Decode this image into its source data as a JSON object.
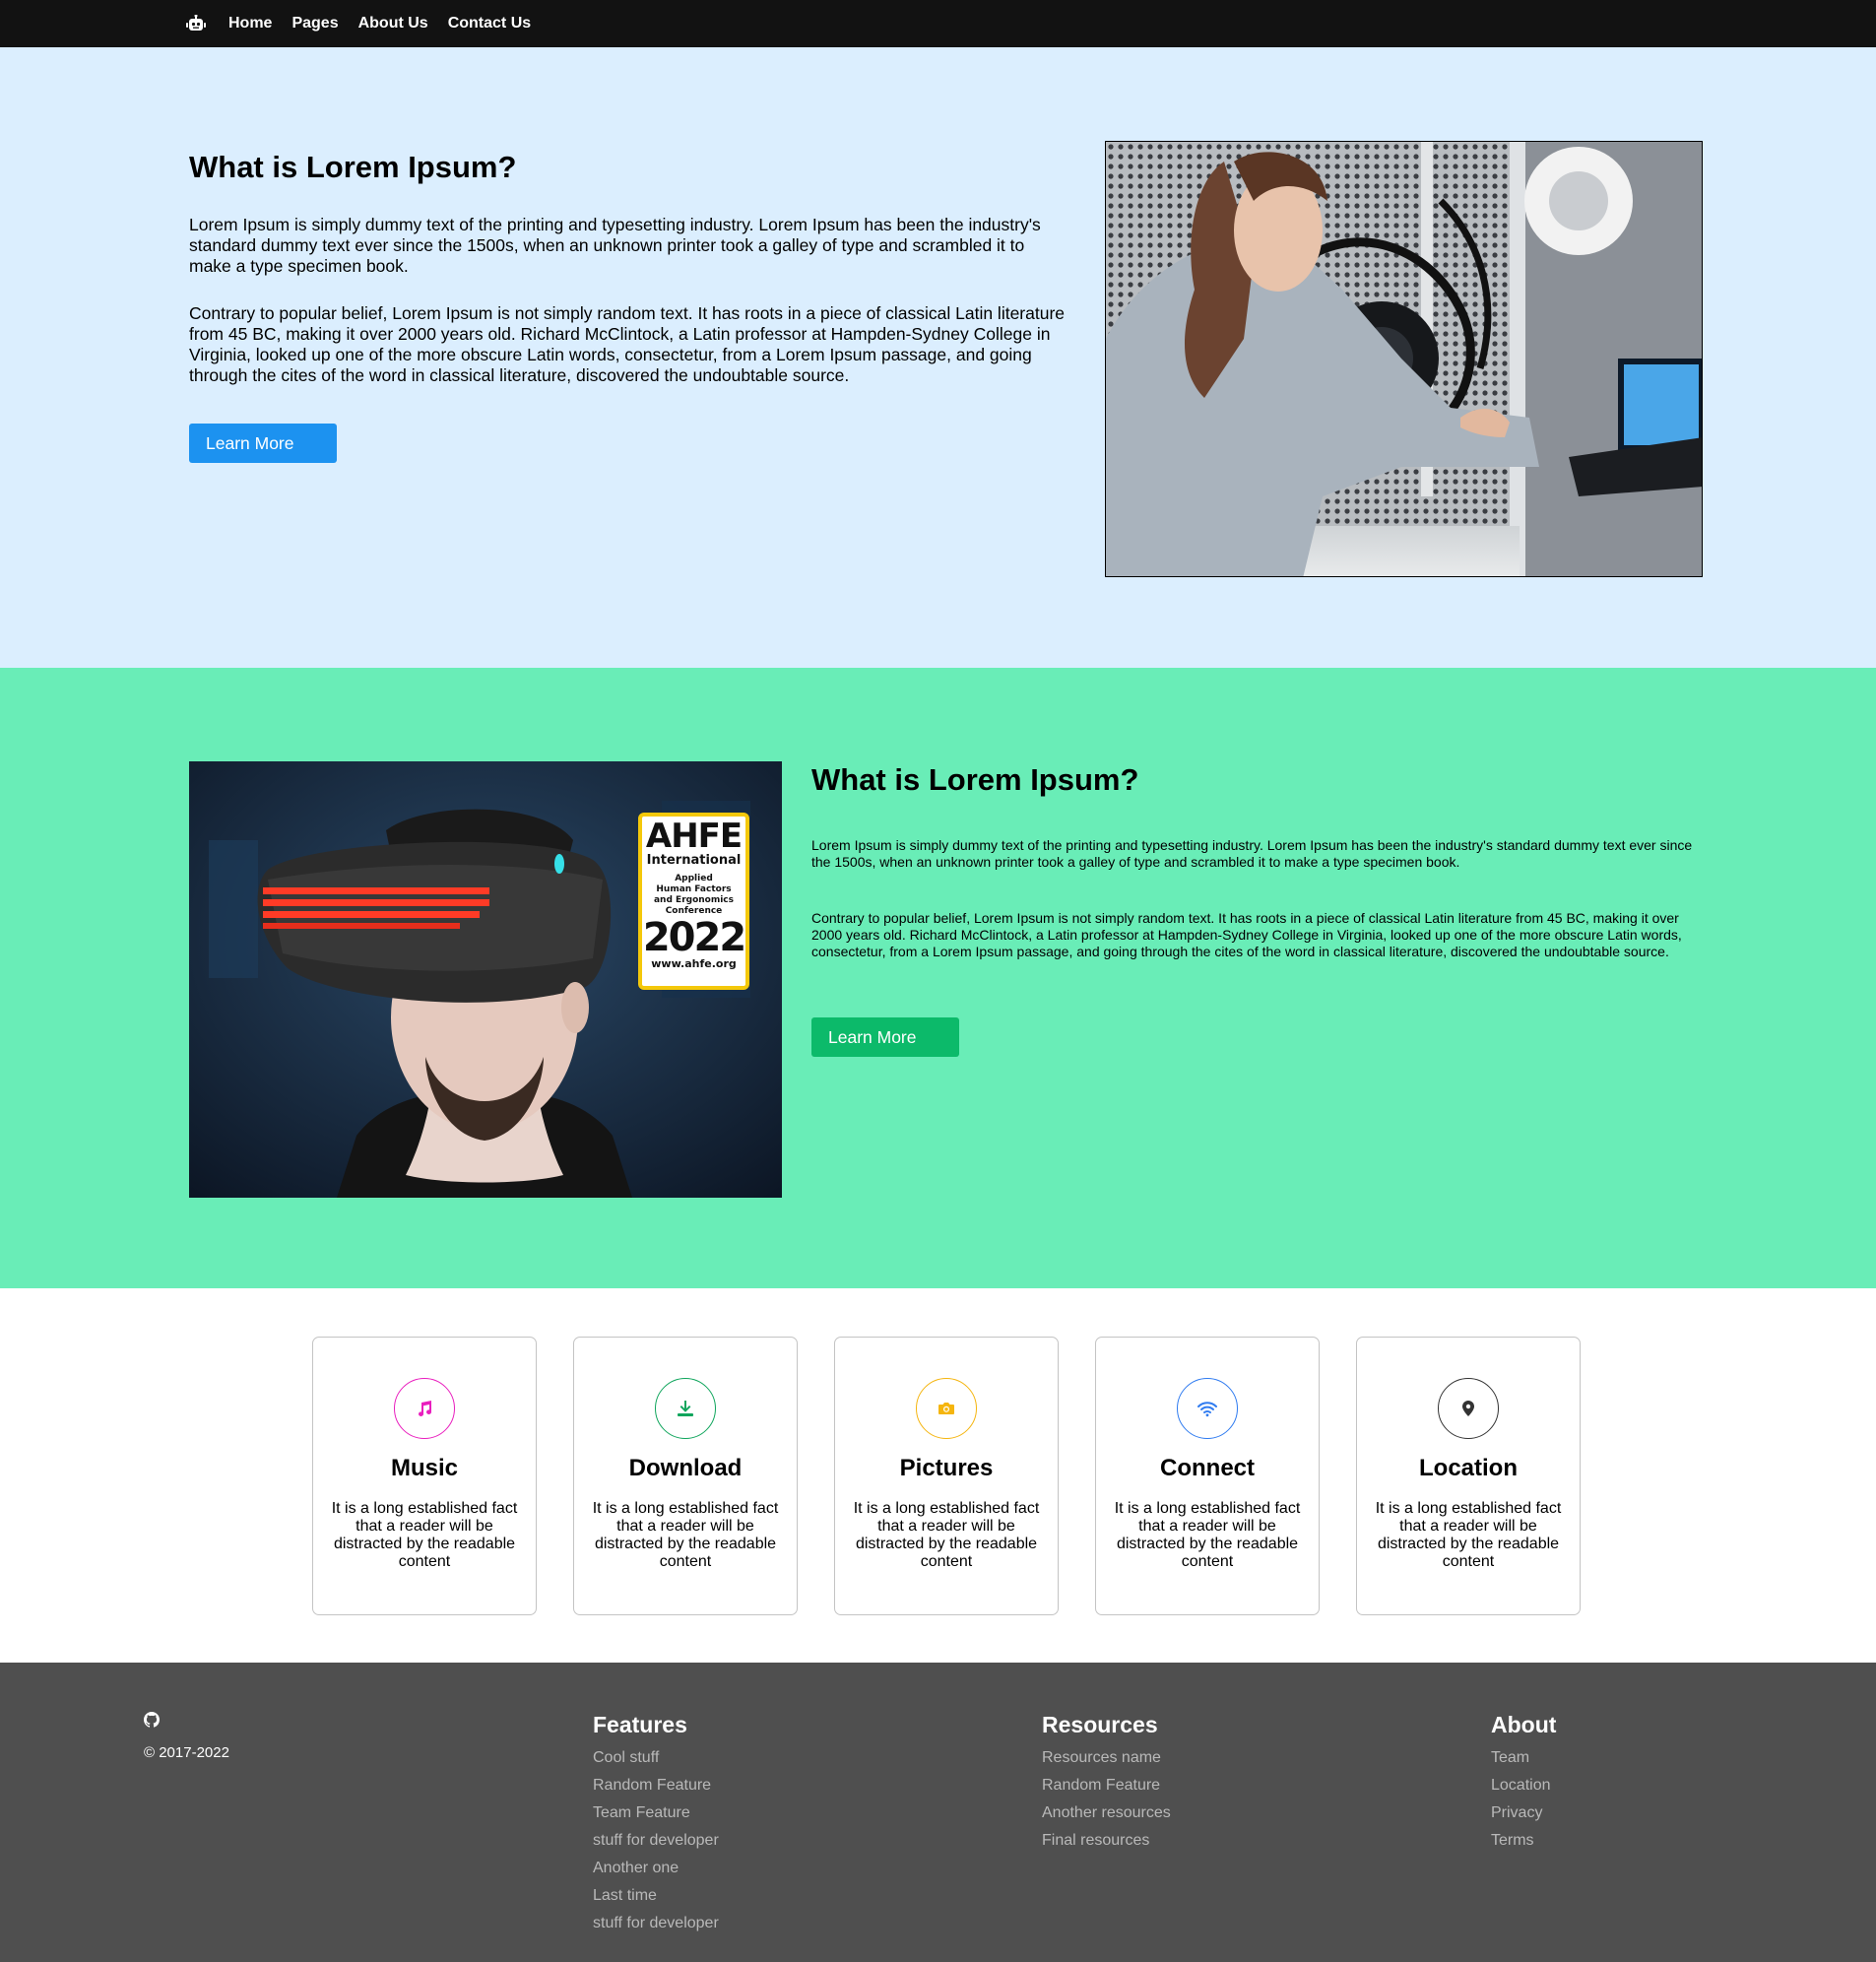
{
  "nav": {
    "logo_icon": "robot-icon",
    "links": [
      "Home",
      "Pages",
      "About Us",
      "Contact Us"
    ]
  },
  "hero1": {
    "title": "What is Lorem Ipsum?",
    "p1": "Lorem Ipsum is simply dummy text of the printing and typesetting industry. Lorem Ipsum has been the industry's standard dummy text ever since the 1500s, when an unknown printer took a galley of type and scrambled it to make a type specimen book.",
    "p2": "Contrary to popular belief, Lorem Ipsum is not simply random text. It has roots in a piece of classical Latin literature from 45 BC, making it over 2000 years old. Richard McClintock, a Latin professor at Hampden-Sydney College in Virginia, looked up one of the more obscure Latin words, consectetur, from a Lorem Ipsum passage, and going through the cites of the word in classical literature, discovered the undoubtable source.",
    "button": "Learn More",
    "button_color": "#1c92f0",
    "background": "#dbeefe"
  },
  "hero2": {
    "title": "What is Lorem Ipsum?",
    "p1": "Lorem Ipsum is simply dummy text of the printing and typesetting industry. Lorem Ipsum has been the industry's standard dummy text ever since the 1500s, when an unknown printer took a galley of type and scrambled it to make a type specimen book.",
    "p2": "Contrary to popular belief, Lorem Ipsum is not simply random text. It has roots in a piece of classical Latin literature from 45 BC, making it over 2000 years old. Richard McClintock, a Latin professor at Hampden-Sydney College in Virginia, looked up one of the more obscure Latin words, consectetur, from a Lorem Ipsum passage, and going through the cites of the word in classical literature, discovered the undoubtable source.",
    "button": "Learn More",
    "button_color": "#0cba6a",
    "background": "#69edb7",
    "badge": {
      "name": "AHFE",
      "sub": "International",
      "line1": "Applied",
      "line2": "Human Factors",
      "line3": "and Ergonomics",
      "line4": "Conference",
      "year": "2022",
      "url": "www.ahfe.org"
    }
  },
  "cards": [
    {
      "title": "Music",
      "text": "It is a long established fact that a reader will be distracted by the readable content",
      "icon": "music-note-icon",
      "color": "#e91ebe"
    },
    {
      "title": "Download",
      "text": "It is a long established fact that a reader will be distracted by the readable content",
      "icon": "download-icon",
      "color": "#0fa55c"
    },
    {
      "title": "Pictures",
      "text": "It is a long established fact that a reader will be distracted by the readable content",
      "icon": "camera-icon",
      "color": "#f5b50f"
    },
    {
      "title": "Connect",
      "text": "It is a long established fact that a reader will be distracted by the readable content",
      "icon": "wifi-icon",
      "color": "#2f7bf0"
    },
    {
      "title": "Location",
      "text": "It is a long established fact that a reader will be distracted by the readable content",
      "icon": "location-pin-icon",
      "color": "#333333"
    }
  ],
  "footer": {
    "brand_icon": "github-icon",
    "copyright": "© 2017-2022",
    "columns": [
      {
        "title": "Features",
        "links": [
          "Cool stuff",
          "Random Feature",
          "Team Feature",
          "stuff for developer",
          "Another one",
          "Last time",
          "stuff for developer"
        ]
      },
      {
        "title": "Resources",
        "links": [
          "Resources name",
          "Random Feature",
          "Another resources",
          "Final resources"
        ]
      },
      {
        "title": "About",
        "links": [
          "Team",
          "Location",
          "Privacy",
          "Terms"
        ]
      }
    ]
  }
}
